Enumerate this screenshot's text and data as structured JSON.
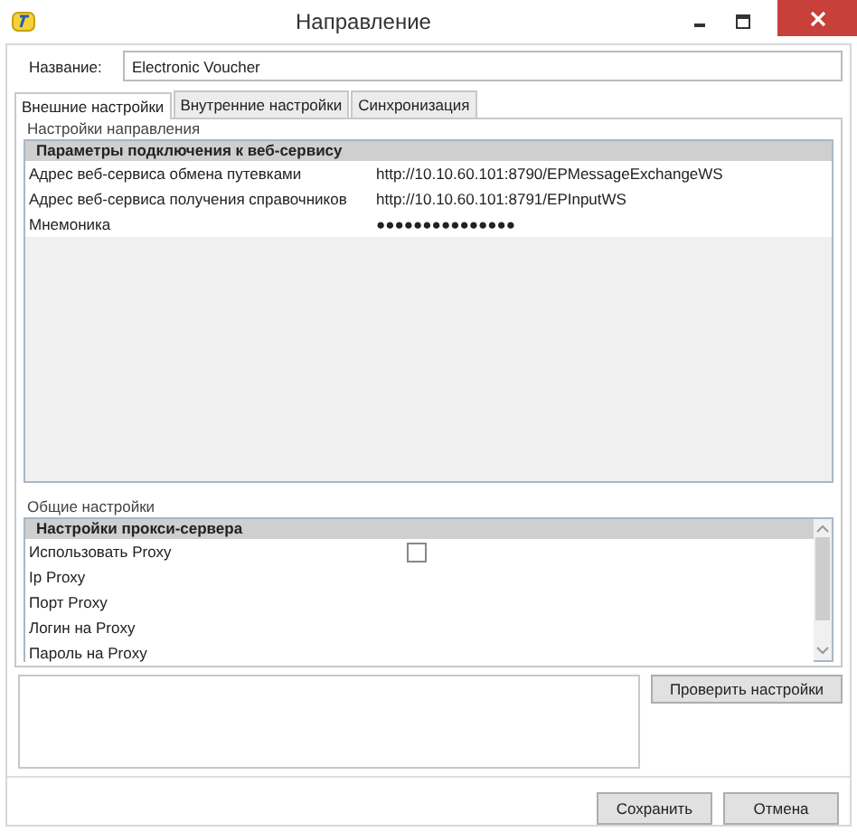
{
  "window": {
    "title": "Направление"
  },
  "name_field": {
    "label": "Название:",
    "value": "Electronic Voucher"
  },
  "tabs": [
    {
      "label": "Внешние настройки",
      "selected": true
    },
    {
      "label": "Внутренние настройки",
      "selected": false
    },
    {
      "label": "Синхронизация",
      "selected": false
    }
  ],
  "direction_group": {
    "title": "Настройки направления",
    "category": "Параметры подключения к веб-сервису",
    "rows": [
      {
        "kind": "text",
        "label": "Адрес веб-сервиса обмена путевками",
        "value": "http://10.10.60.101:8790/EPMessageExchangeWS"
      },
      {
        "kind": "text",
        "label": "Адрес веб-сервиса получения справочников",
        "value": "http://10.10.60.101:8791/EPInputWS"
      },
      {
        "kind": "text",
        "label": "Мнемоника",
        "value": "●●●●●●●●●●●●●●●"
      }
    ]
  },
  "general_group": {
    "title": "Общие настройки",
    "category": "Настройки прокси-сервера",
    "rows": [
      {
        "kind": "checkbox",
        "label": "Использовать Proxy",
        "checked": false
      },
      {
        "kind": "text",
        "label": "Ip Proxy"
      },
      {
        "kind": "text",
        "label": "Порт Proxy"
      },
      {
        "kind": "text",
        "label": "Логин на Proxy"
      },
      {
        "kind": "text",
        "label": "Пароль на Proxy"
      }
    ]
  },
  "check_button": "Проверить настройки",
  "buttons": [
    "Сохранить",
    "Отмена"
  ]
}
